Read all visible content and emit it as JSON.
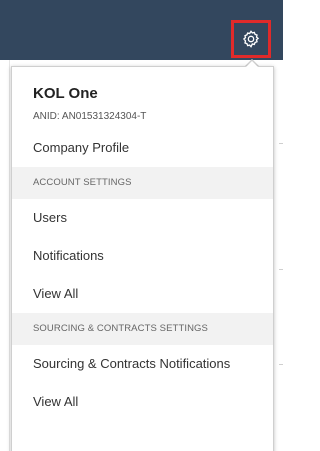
{
  "header": {
    "settings_icon": "gear-icon",
    "highlight_color": "#e02a2a",
    "bar_color": "#33475e"
  },
  "company": {
    "name": "KOL One",
    "anid": "ANID: AN01531324304-T"
  },
  "menu": {
    "company_profile": "Company Profile",
    "account_settings_header": "ACCOUNT SETTINGS",
    "users": "Users",
    "notifications": "Notifications",
    "view_all": "View All",
    "sourcing_settings_header": "SOURCING & CONTRACTS SETTINGS",
    "sourcing_notifications": "Sourcing & Contracts Notifications",
    "sourcing_view_all": "View All"
  }
}
